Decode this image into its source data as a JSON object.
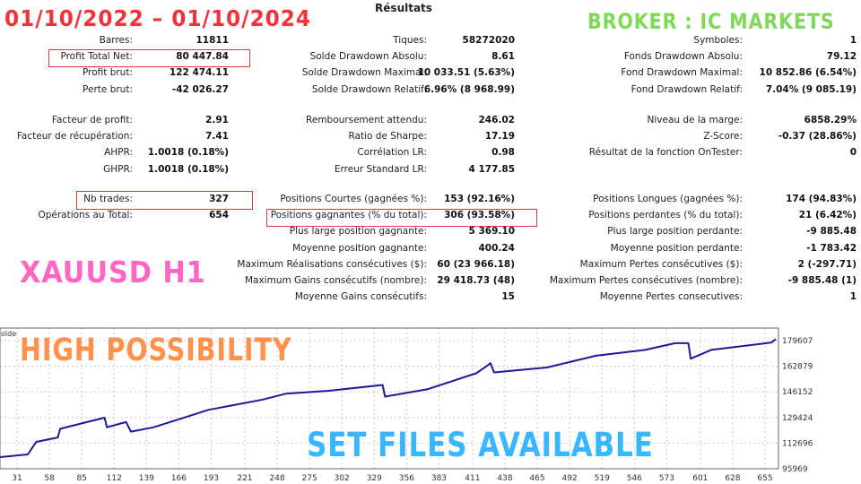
{
  "report": {
    "title": "Résultats",
    "columns": [
      [
        [
          {
            "label": "Barres:",
            "value": "11811"
          },
          {
            "label": "Profit Total Net:",
            "value": "80 447.84"
          },
          {
            "label": "Profit brut:",
            "value": "122 474.11"
          },
          {
            "label": "Perte brut:",
            "value": "-42 026.27"
          }
        ],
        [
          {
            "label": "Facteur de profit:",
            "value": "2.91"
          },
          {
            "label": "Facteur de récupération:",
            "value": "7.41"
          },
          {
            "label": "AHPR:",
            "value": "1.0018 (0.18%)"
          },
          {
            "label": "GHPR:",
            "value": "1.0018 (0.18%)"
          }
        ],
        [
          {
            "label": "Nb trades:",
            "value": "327"
          },
          {
            "label": "Opérations au Total:",
            "value": "654"
          }
        ]
      ],
      [
        [
          {
            "label": "Tiques:",
            "value": "58272020"
          },
          {
            "label": "Solde Drawdown Absolu:",
            "value": "8.61"
          },
          {
            "label": "Solde Drawdown Maximal:",
            "value": "10 033.51 (5.63%)"
          },
          {
            "label": "Solde Drawdown Relatif:",
            "value": "6.96% (8 968.99)"
          }
        ],
        [
          {
            "label": "Remboursement attendu:",
            "value": "246.02"
          },
          {
            "label": "Ratio de Sharpe:",
            "value": "17.19"
          },
          {
            "label": "Corrélation LR:",
            "value": "0.98"
          },
          {
            "label": "Erreur Standard LR:",
            "value": "4 177.85"
          }
        ],
        [
          {
            "label": "Positions Courtes (gagnées %):",
            "value": "153 (92.16%)"
          },
          {
            "label": "Positions gagnantes (% du total):",
            "value": "306 (93.58%)"
          },
          {
            "label": "Plus large position gagnante:",
            "value": "5 369.10"
          },
          {
            "label": "Moyenne position gagnante:",
            "value": "400.24"
          },
          {
            "label": "Maximum Réalisations consécutives ($):",
            "value": "60 (23 966.18)"
          },
          {
            "label": "Maximum Gains consécutifs (nombre):",
            "value": "29 418.73 (48)"
          },
          {
            "label": "Moyenne Gains consécutifs:",
            "value": "15"
          }
        ]
      ],
      [
        [
          {
            "label": "Symboles:",
            "value": "1"
          },
          {
            "label": "Fonds Drawdown Absolu:",
            "value": "79.12"
          },
          {
            "label": "Fond Drawdown Maximal:",
            "value": "10 852.86 (6.54%)"
          },
          {
            "label": "Fond Drawdown Relatif:",
            "value": "7.04% (9 085.19)"
          }
        ],
        [
          {
            "label": "Niveau de la marge:",
            "value": "6858.29%"
          },
          {
            "label": "Z-Score:",
            "value": "-0.37 (28.86%)"
          },
          {
            "label": "Résultat de la fonction OnTester:",
            "value": "0"
          }
        ],
        [
          {
            "label": "Positions Longues (gagnées %):",
            "value": "174 (94.83%)"
          },
          {
            "label": "Positions perdantes (% du total):",
            "value": "21 (6.42%)"
          },
          {
            "label": "Plus large position perdante:",
            "value": "-9 885.48"
          },
          {
            "label": "Moyenne position perdante:",
            "value": "-1 783.42"
          },
          {
            "label": "Maximum Pertes consécutives ($):",
            "value": "2 (-297.71)"
          },
          {
            "label": "Maximum Pertes consécutives (nombre):",
            "value": "-9 885.48 (1)"
          },
          {
            "label": "Moyenne Pertes consecutives:",
            "value": "1"
          }
        ]
      ]
    ],
    "highlight_color": "#e0383e"
  },
  "overlays": {
    "date_range": {
      "text": "01/10/2022  – 01/10/2024",
      "color": "#f2323a"
    },
    "broker": {
      "text": "BROKER : IC MARKETS",
      "color": "#7ed957"
    },
    "symbol": {
      "text": "XAUUSD H1",
      "color": "#ff66c4"
    },
    "tagline": {
      "text": "HIGH POSSIBILITY",
      "color": "#ff914d"
    },
    "set_files": {
      "text": "SET FILES AVAILABLE",
      "color": "#38b6ff"
    }
  },
  "chart_data": {
    "type": "line",
    "series_label": "olde",
    "line_color": "#1a1a9c",
    "grid": true,
    "xlim": [
      17,
      667
    ],
    "ylim": [
      95969,
      183000
    ],
    "x_ticks": [
      "31",
      "58",
      "85",
      "112",
      "139",
      "166",
      "193",
      "221",
      "248",
      "275",
      "302",
      "329",
      "356",
      "383",
      "411",
      "438",
      "465",
      "492",
      "519",
      "546",
      "573",
      "601",
      "628",
      "655"
    ],
    "y_ticks": [
      "179607",
      "162879",
      "146152",
      "129424",
      "112696",
      "95969"
    ],
    "points": [
      [
        17,
        103600
      ],
      [
        40,
        105310
      ],
      [
        47,
        113500
      ],
      [
        65,
        116360
      ],
      [
        67,
        122080
      ],
      [
        104,
        129310
      ],
      [
        106,
        123030
      ],
      [
        122,
        126460
      ],
      [
        126,
        120170
      ],
      [
        145,
        123030
      ],
      [
        191,
        134460
      ],
      [
        236,
        141130
      ],
      [
        255,
        144940
      ],
      [
        291,
        146840
      ],
      [
        336,
        150650
      ],
      [
        338,
        143030
      ],
      [
        373,
        147800
      ],
      [
        414,
        158270
      ],
      [
        423,
        163030
      ],
      [
        426,
        164940
      ],
      [
        429,
        158840
      ],
      [
        473,
        162080
      ],
      [
        514,
        169700
      ],
      [
        555,
        173510
      ],
      [
        580,
        177890
      ],
      [
        591,
        177890
      ],
      [
        593,
        167800
      ],
      [
        610,
        173510
      ],
      [
        660,
        178270
      ],
      [
        664,
        180560
      ]
    ]
  }
}
